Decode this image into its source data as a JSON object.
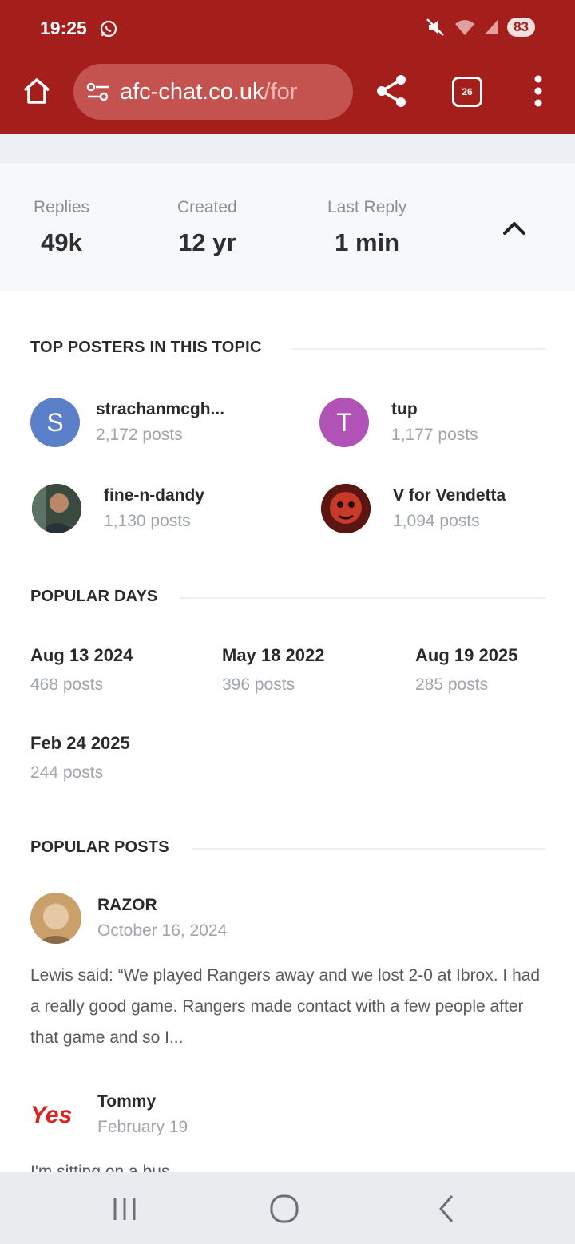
{
  "status_bar": {
    "time": "19:25",
    "battery": "83"
  },
  "browser": {
    "url_main": "afc-chat.co.uk",
    "url_rest": "/for",
    "tab_count": "26"
  },
  "stats": [
    {
      "label": "Replies",
      "value": "49k"
    },
    {
      "label": "Created",
      "value": "12 yr"
    },
    {
      "label": "Last Reply",
      "value": "1 min"
    }
  ],
  "top_posters": {
    "title": "TOP POSTERS IN THIS TOPIC",
    "items": [
      {
        "name": "strachanmcgh...",
        "posts": "2,172 posts",
        "initial": "S",
        "color": "#5b7fc9"
      },
      {
        "name": "tup",
        "posts": "1,177 posts",
        "initial": "T",
        "color": "#b052b6"
      },
      {
        "name": "fine-n-dandy",
        "posts": "1,130 posts",
        "initial": "",
        "color": "#4a5560"
      },
      {
        "name": "V for Vendetta",
        "posts": "1,094 posts",
        "initial": "",
        "color": "#7a1c16"
      }
    ]
  },
  "popular_days": {
    "title": "POPULAR DAYS",
    "items": [
      {
        "date": "Aug 13 2024",
        "posts": "468 posts"
      },
      {
        "date": "May 18 2022",
        "posts": "396 posts"
      },
      {
        "date": "Aug 19 2025",
        "posts": "285 posts"
      },
      {
        "date": "Feb 24 2025",
        "posts": "244 posts"
      }
    ]
  },
  "popular_posts": {
    "title": "POPULAR POSTS",
    "items": [
      {
        "author": "RAZOR",
        "date": "October 16, 2024",
        "body": "Lewis said: “We played Rangers away and we lost 2-0 at Ibrox. I had a really good game. Rangers made contact with a few people after that game and so I..."
      },
      {
        "author": "Tommy",
        "date": "February 19",
        "body": "I'm sitting on a bus",
        "avatar_text": "Yes"
      }
    ]
  }
}
